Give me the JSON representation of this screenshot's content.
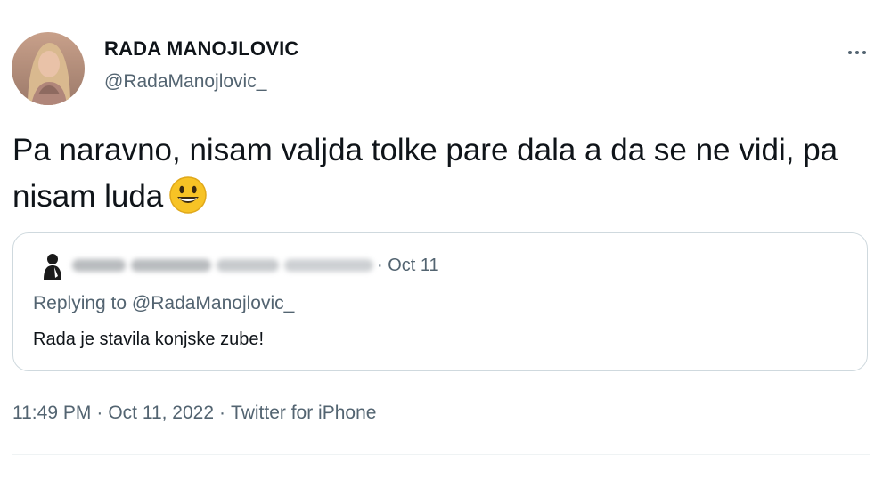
{
  "author": {
    "display_name": "RADA MANOJLOVIC",
    "handle": "@RadaManojlovic_"
  },
  "tweet": {
    "text": "Pa naravno, nisam valjda tolke pare dala a da se ne vidi, pa nisam luda",
    "emoji": "grinning-face-emoji"
  },
  "quoted_tweet": {
    "date_label": "· Oct 11",
    "replying_prefix": "Replying to ",
    "replying_handle": "@RadaManojlovic_",
    "text": "Rada je stavila konjske zube!"
  },
  "meta": {
    "time": "11:49 PM",
    "separator": "·",
    "date": "Oct 11, 2022",
    "source": "Twitter for iPhone"
  },
  "icons": {
    "more": "more-horizontal-icon",
    "quote_avatar": "person-silhouette-icon"
  },
  "colors": {
    "text_primary": "#0f1419",
    "text_secondary": "#536471",
    "border": "#cfd9de",
    "emoji_yellow": "#f7c325"
  }
}
